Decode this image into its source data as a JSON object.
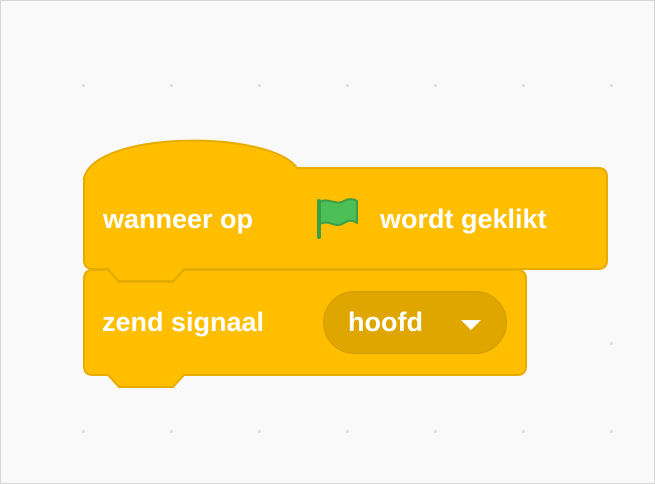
{
  "colors": {
    "event_block": "#ffbf00",
    "event_block_border": "#e6ac00",
    "dropdown_fill": "#e0a600",
    "text": "#ffffff",
    "flag_green": "#4cbf56"
  },
  "hat_block": {
    "label_before": "wanneer op",
    "icon": "green-flag-icon",
    "label_after": "wordt geklikt"
  },
  "broadcast_block": {
    "label": "zend signaal",
    "dropdown_value": "hoofd",
    "dropdown_icon": "chevron-down-icon"
  }
}
